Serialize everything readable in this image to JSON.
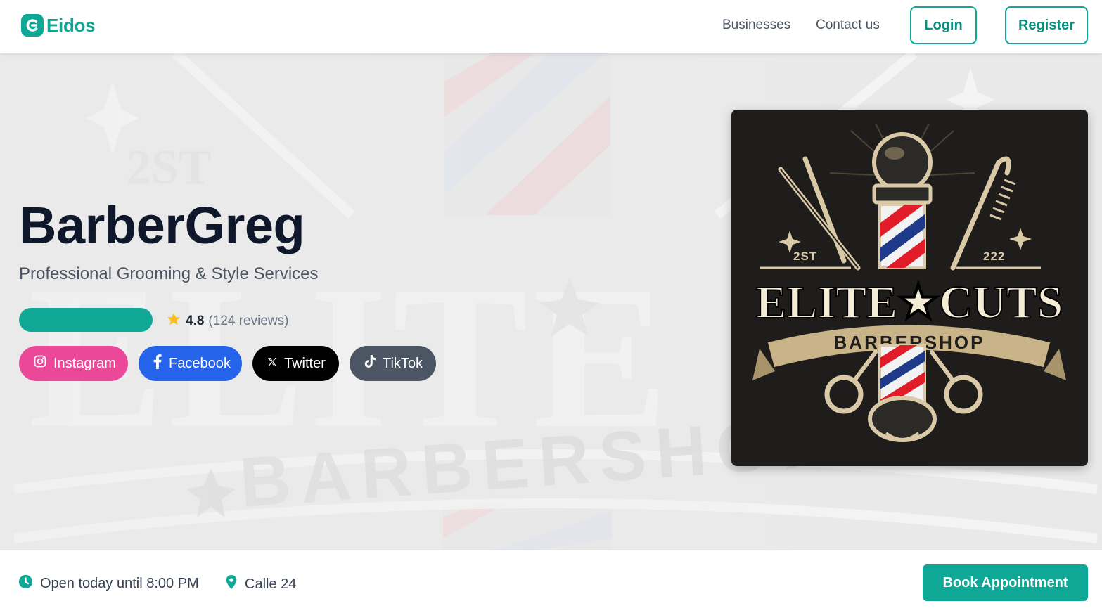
{
  "nav": {
    "brand": "Eidos",
    "links": {
      "businesses": "Businesses",
      "contact": "Contact us"
    },
    "login": "Login",
    "register": "Register"
  },
  "hero": {
    "title": "BarberGreg",
    "subtitle": "Professional Grooming & Style Services",
    "rating": {
      "value": "4.8",
      "count": "(124 reviews)",
      "icon": "star-icon"
    },
    "socials": [
      {
        "label": "Instagram",
        "icon": "instagram-icon",
        "color": "#ec4899"
      },
      {
        "label": "Facebook",
        "icon": "facebook-icon",
        "color": "#2563eb"
      },
      {
        "label": "Twitter",
        "icon": "x-icon",
        "color": "#000000"
      },
      {
        "label": "TikTok",
        "icon": "tiktok-icon",
        "color": "#4b5563"
      }
    ],
    "logo": {
      "line1": "ELITE★CUTS",
      "line2": "BARBERSHOP",
      "left_mark": "2ST",
      "right_mark": "222"
    }
  },
  "info": {
    "hours": "Open today until 8:00 PM",
    "location": "Calle 24",
    "book": "Book Appointment"
  },
  "colors": {
    "accent": "#0fa896",
    "title": "#0f172a",
    "star": "#fbbf24"
  }
}
